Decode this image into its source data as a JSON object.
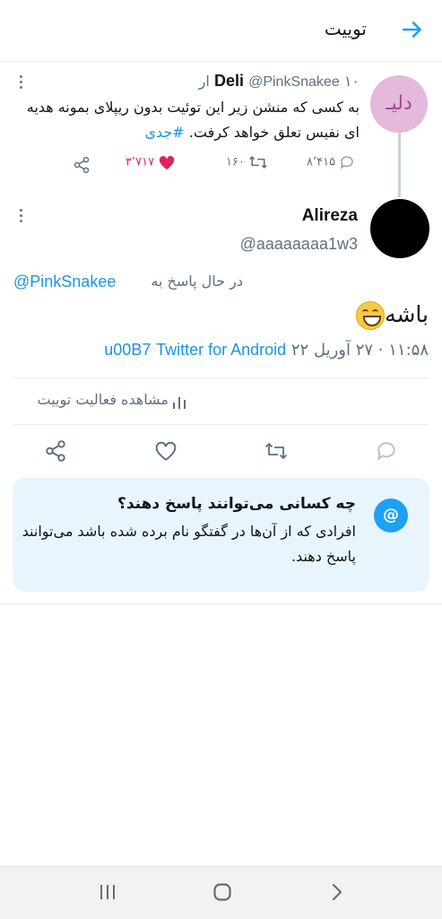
{
  "header": {
    "title": "توییت",
    "back_icon": "arrow-right-icon"
  },
  "parent": {
    "avatar_text": "دلیـ",
    "name": "Deli",
    "handle": "@PinkSnakee",
    "time": "۱۰ ار",
    "text": "به کسی که منشن زیر این توئیت بدون ریپلای بمونه هدیه ای نفیس تعلق خواهد کرفت.",
    "hashtag": "#جدی",
    "replies": "۸٬۴۱۵",
    "retweets": "۱۶۰",
    "likes": "۳٬۷۱۷",
    "like_color": "#e0245e"
  },
  "main": {
    "name": "Alireza",
    "handle": "@aaaaaaaa1w3",
    "reply_prefix": "در حال پاسخ به",
    "reply_handle": "@PinkSnakee",
    "text": "باشه",
    "time": "۱۱:۵۸",
    "date": "۲۷ آوریل ۲۲",
    "source": "Twitter for Android",
    "sep_code": "u00B7",
    "activity": "مشاهده فعالیت توییت"
  },
  "card": {
    "title": "چه کسانی می‌توانند پاسخ دهند؟",
    "body": "افرادی که از آن‌ها در گفتگو نام برده شده باشد می‌توانند پاسخ دهند.",
    "icon_text": "@"
  },
  "colors": {
    "accent": "#1da1f2",
    "link": "#1b95e0",
    "muted": "#5b7083"
  }
}
